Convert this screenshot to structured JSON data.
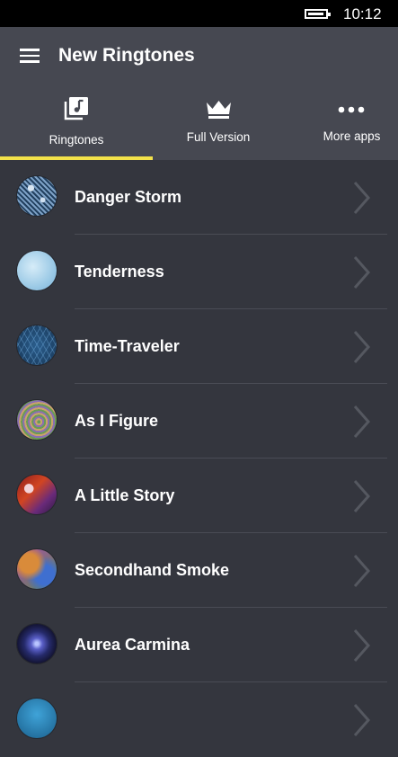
{
  "status": {
    "time": "10:12"
  },
  "header": {
    "title": "New Ringtones"
  },
  "tabs": [
    {
      "label": "Ringtones",
      "icon": "music-library-icon",
      "selected": true
    },
    {
      "label": "Full Version",
      "icon": "crown-icon"
    },
    {
      "label": "More apps",
      "icon": "more-dots-icon"
    }
  ],
  "accent": "#f3e24a",
  "ringtones": [
    {
      "name": "Danger Storm"
    },
    {
      "name": "Tenderness"
    },
    {
      "name": "Time-Traveler"
    },
    {
      "name": "As I Figure"
    },
    {
      "name": "A Little Story"
    },
    {
      "name": "Secondhand Smoke"
    },
    {
      "name": "Aurea Carmina"
    },
    {
      "name": ""
    }
  ]
}
